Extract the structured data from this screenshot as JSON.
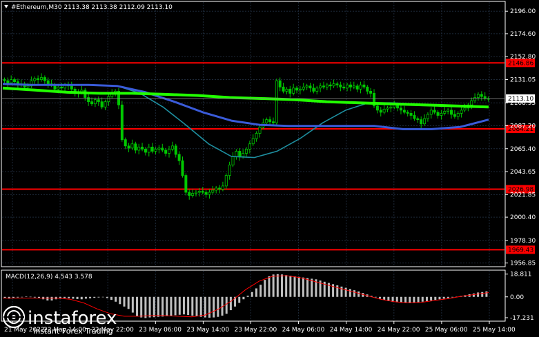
{
  "header": {
    "symbol_line": "#Ethereum,M30 2113.38 2113.38 2112.09 2113.10"
  },
  "macd_header": {
    "label": "MACD(12,26,9) 4.543 3.578"
  },
  "logo": {
    "brand": "instaforex",
    "tagline": "Instant Forex Trading"
  },
  "colors": {
    "background": "#000000",
    "grid": "#1e2a3a",
    "candle": "#00c800",
    "level": "#ff0000",
    "ma_fast": "#1e8fa0",
    "ma_mid": "#3a5bd9",
    "ma_slow": "#22ff00",
    "macd_hist": "#c0c0c0",
    "macd_signal": "#ff0000",
    "current_price_bg": "#ffffff"
  },
  "chart_data": [
    {
      "type": "candlestick",
      "title": "#Ethereum,M30",
      "y_ticks": [
        "2196.00",
        "2174.60",
        "2152.80",
        "2131.05",
        "2108.95",
        "2087.20",
        "2065.40",
        "2043.65",
        "2021.85",
        "2000.40",
        "1978.30",
        "1956.85"
      ],
      "ylim": [
        1954.0,
        2204.0
      ],
      "x_tick_labels": [
        "21 May 2022",
        "22 May 14:00",
        "22 May 22:00",
        "23 May 06:00",
        "23 May 14:00",
        "23 May 22:00",
        "24 May 06:00",
        "24 May 14:00",
        "24 May 22:00",
        "25 May 06:00",
        "25 May 14:00"
      ],
      "current_price": "2113.10",
      "horizontal_levels": [
        "2146.86",
        "2084.21",
        "2026.98",
        "1969.43"
      ],
      "close_series": [
        2130,
        2128,
        2131,
        2129,
        2126,
        2127,
        2124,
        2125,
        2130,
        2132,
        2131,
        2133,
        2130,
        2127,
        2126,
        2122,
        2124,
        2123,
        2126,
        2125,
        2122,
        2118,
        2119,
        2121,
        2114,
        2110,
        2108,
        2112,
        2110,
        2105,
        2110,
        2115,
        2118,
        2120,
        2107,
        2074,
        2068,
        2066,
        2070,
        2064,
        2067,
        2065,
        2062,
        2067,
        2063,
        2065,
        2066,
        2064,
        2061,
        2065,
        2068,
        2060,
        2054,
        2040,
        2024,
        2021,
        2023,
        2024,
        2025,
        2024,
        2022,
        2024,
        2026,
        2028,
        2027,
        2030,
        2040,
        2050,
        2058,
        2063,
        2058,
        2061,
        2065,
        2070,
        2075,
        2080,
        2086,
        2090,
        2093,
        2091,
        2090,
        2130,
        2124,
        2120,
        2122,
        2118,
        2123,
        2121,
        2122,
        2124,
        2125,
        2123,
        2120,
        2123,
        2125,
        2124,
        2126,
        2125,
        2127,
        2126,
        2124,
        2123,
        2126,
        2124,
        2125,
        2122,
        2126,
        2124,
        2120,
        2118,
        2106,
        2102,
        2100,
        2103,
        2104,
        2105,
        2107,
        2104,
        2102,
        2100,
        2099,
        2097,
        2094,
        2093,
        2089,
        2094,
        2098,
        2102,
        2100,
        2097,
        2099,
        2101,
        2102,
        2098,
        2096,
        2099,
        2102,
        2104,
        2107,
        2111,
        2114,
        2117,
        2115,
        2113,
        2113
      ],
      "ma_slow": [
        2123,
        2121,
        2119,
        2118,
        2118,
        2117,
        2116,
        2114,
        2113,
        2112,
        2110,
        2109,
        2108,
        2107,
        2106,
        2105
      ],
      "ma_mid": [
        2127,
        2126,
        2126,
        2126,
        2125,
        2119,
        2110,
        2100,
        2092,
        2088,
        2087,
        2087,
        2087,
        2087,
        2084,
        2084,
        2086,
        2093
      ],
      "ma_fast": [
        2125,
        2118,
        2105,
        2088,
        2070,
        2058,
        2057,
        2063,
        2075,
        2090,
        2102,
        2109,
        2109,
        2108
      ]
    },
    {
      "type": "bar",
      "title": "MACD(12,26,9) 4.543 3.578",
      "y_ticks": [
        "18.811",
        "0.00",
        "-17.231"
      ],
      "ylim": [
        -19.5,
        21.5
      ],
      "values": [
        -1,
        -1.5,
        -1,
        -0.5,
        -0.2,
        0.2,
        0.1,
        -0.5,
        -1,
        -2,
        -3,
        -3,
        -2,
        -1,
        -1,
        -1.2,
        -1.5,
        -1.8,
        -2,
        -1.5,
        -1.2,
        -0.8,
        -0.5,
        -0.3,
        -1,
        -2.5,
        -4,
        -6,
        -8,
        -10,
        -13,
        -16,
        -17,
        -17.5,
        -17,
        -16.8,
        -16.5,
        -16.3,
        -16,
        -15.8,
        -15.2,
        -14.8,
        -14.5,
        -15,
        -15.5,
        -16,
        -16.5,
        -17,
        -17.2,
        -17,
        -16.5,
        -15.5,
        -14,
        -11,
        -8,
        -5,
        -2,
        1,
        4,
        7,
        10,
        14,
        17,
        18.5,
        18.8,
        18.5,
        18,
        17.5,
        17,
        16.5,
        16,
        15.5,
        15,
        14.5,
        13.5,
        12.5,
        11.5,
        10.5,
        9.5,
        8.5,
        7.5,
        6.5,
        5.5,
        4.5,
        3.2,
        2,
        0.8,
        -0.4,
        -1.5,
        -2.5,
        -3.5,
        -4.2,
        -4.5,
        -4.8,
        -5,
        -5.2,
        -5,
        -4.6,
        -4,
        -3.5,
        -3,
        -2.5,
        -2,
        -1.5,
        -1,
        -0.4,
        0.2,
        0.8,
        1.4,
        2.2,
        2.8,
        3.6,
        4,
        4.543
      ],
      "signal": [
        -1,
        -1,
        -1,
        -1,
        -1,
        -2,
        -5,
        -10,
        -14,
        -16,
        -16,
        -15.5,
        -15.5,
        -16,
        -16.5,
        -15,
        -10,
        -3,
        6,
        13,
        17,
        17.5,
        16,
        13,
        10,
        7,
        4,
        1,
        -2,
        -4,
        -5,
        -4.5,
        -3,
        -1.5,
        0.5,
        2,
        3.578
      ]
    }
  ]
}
